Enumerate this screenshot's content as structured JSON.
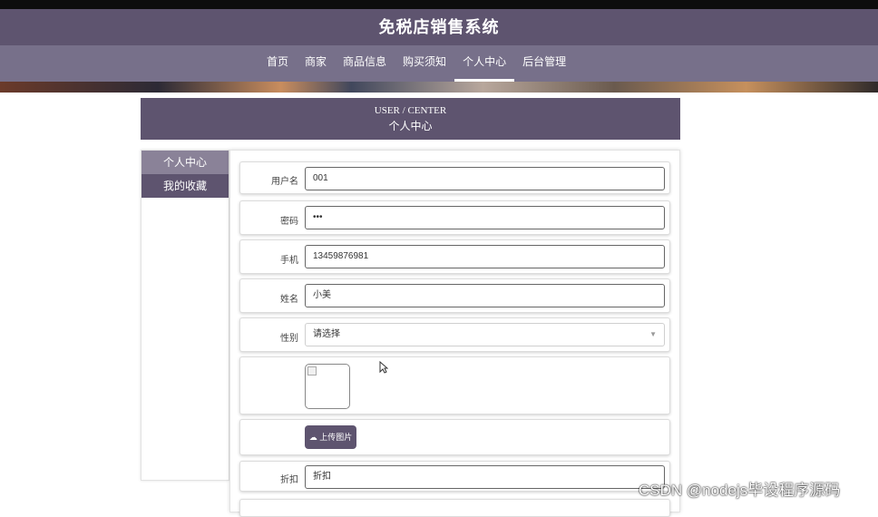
{
  "site": {
    "title": "免税店销售系统"
  },
  "nav": {
    "items": [
      {
        "label": "首页",
        "active": false
      },
      {
        "label": "商家",
        "active": false
      },
      {
        "label": "商品信息",
        "active": false
      },
      {
        "label": "购买须知",
        "active": false
      },
      {
        "label": "个人中心",
        "active": true
      },
      {
        "label": "后台管理",
        "active": false
      }
    ]
  },
  "header": {
    "en": "USER / CENTER",
    "cn": "个人中心"
  },
  "sidebar": {
    "items": [
      {
        "label": "个人中心"
      },
      {
        "label": "我的收藏"
      }
    ]
  },
  "form": {
    "username": {
      "label": "用户名",
      "value": "001"
    },
    "password": {
      "label": "密码",
      "value": "•••"
    },
    "phone": {
      "label": "手机",
      "value": "13459876981"
    },
    "name": {
      "label": "姓名",
      "value": "小美"
    },
    "gender": {
      "label": "性别",
      "value": "请选择"
    },
    "upload_label": "上传图片",
    "discount": {
      "label": "折扣",
      "value": "折扣"
    }
  },
  "watermark": "CSDN @nodejs毕设程序源码",
  "colors": {
    "primary": "#5e546f",
    "nav": "#77708a",
    "sidebar_active": "#8a8298"
  }
}
